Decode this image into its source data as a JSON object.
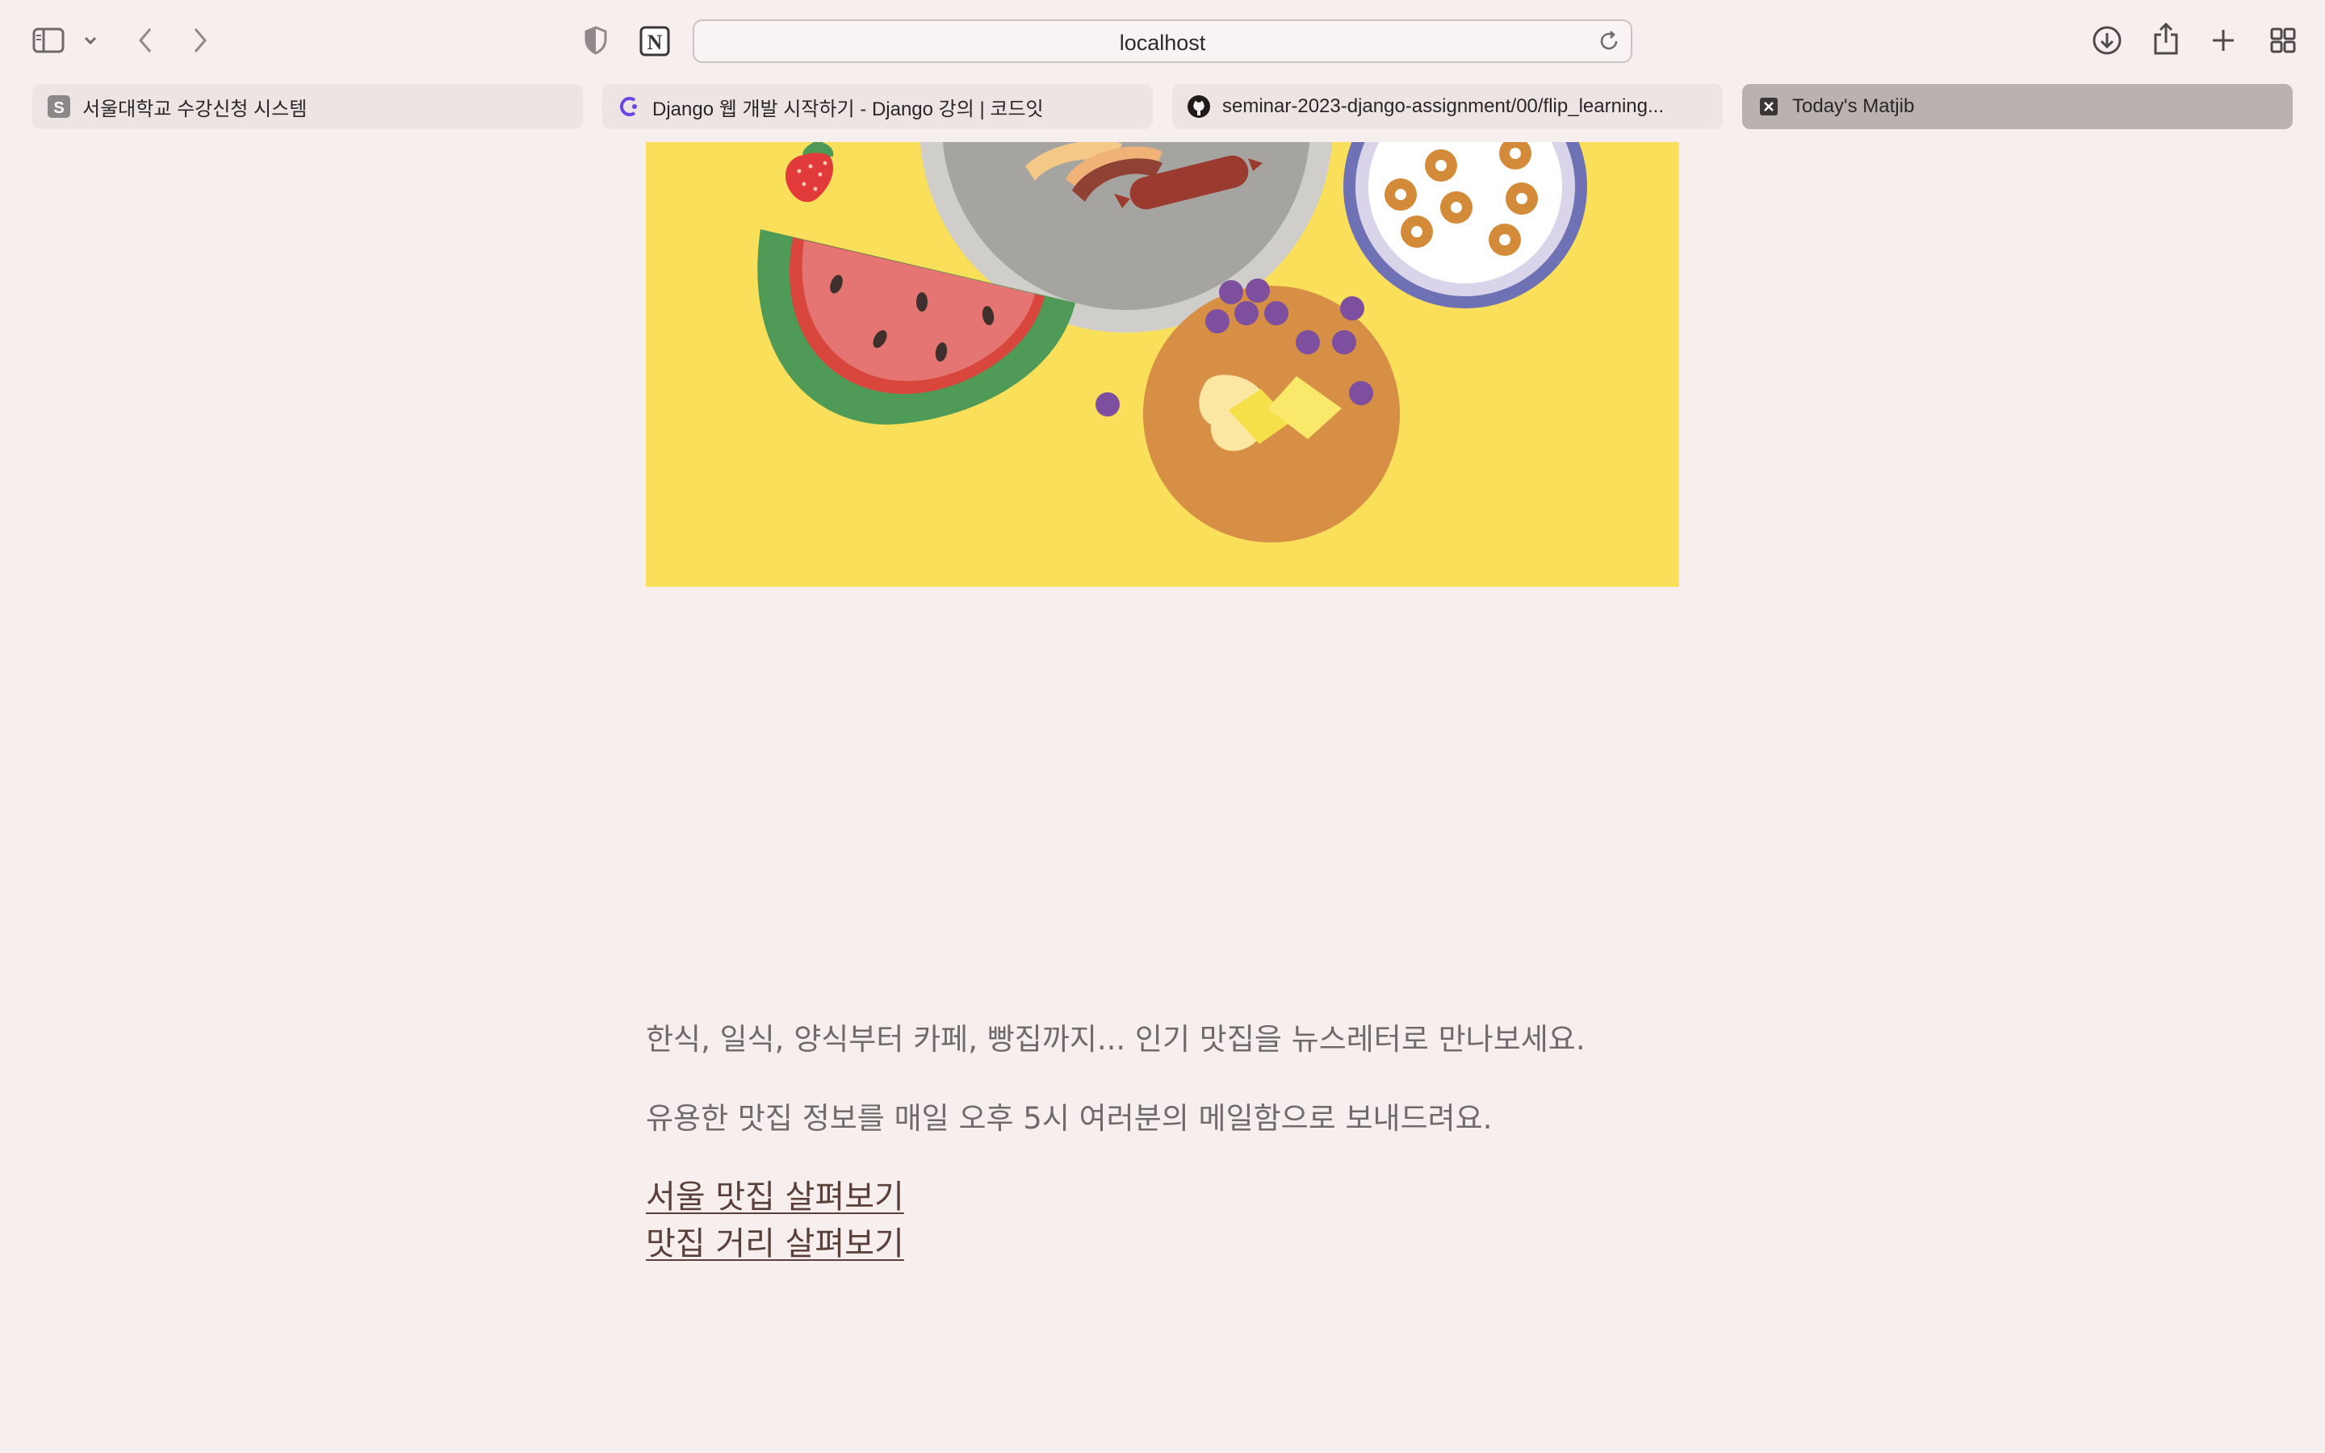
{
  "browser": {
    "url": "localhost",
    "tabs": [
      {
        "title": "서울대학교 수강신청 시스템",
        "favicon": "s-letter-icon",
        "active": false
      },
      {
        "title": "Django 웹 개발 시작하기 - Django 강의 | 코드잇",
        "favicon": "codeit-icon",
        "active": false
      },
      {
        "title": "seminar-2023-django-assignment/00/flip_learning...",
        "favicon": "github-icon",
        "active": false
      },
      {
        "title": "Today's Matjib",
        "favicon": "x-box-icon",
        "active": true
      }
    ]
  },
  "page": {
    "hero_image": "breakfast-illustration",
    "description_1": "한식, 일식, 양식부터 카페, 빵집까지... 인기 맛집을 뉴스레터로 만나보세요.",
    "description_2": "유용한 맛집 정보를 매일 오후 5시 여러분의 메일함으로 보내드려요.",
    "link_seoul": "서울 맛집 살펴보기",
    "link_street": "맛집 거리 살펴보기"
  },
  "colors": {
    "background": "#f7efed",
    "hero_yellow": "#f9df5a",
    "link": "#5a3f3a",
    "text": "#6f6b6a"
  }
}
